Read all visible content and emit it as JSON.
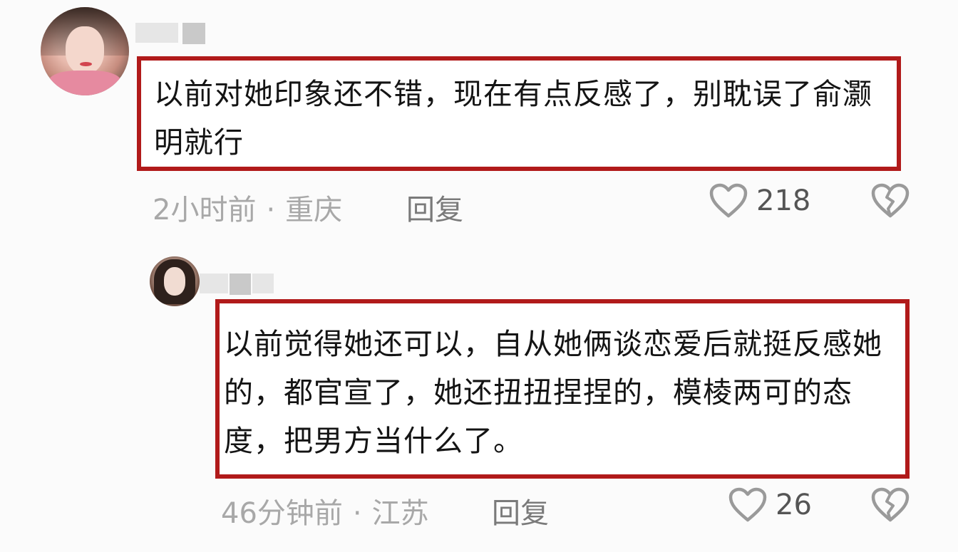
{
  "comments": [
    {
      "text": "以前对她印象还不错，现在有点反感了，别耽误了俞灏明就行",
      "time": "2小时前",
      "separator": "·",
      "location": "重庆",
      "reply_label": "回复",
      "likes": "218"
    },
    {
      "text": "以前觉得她还可以，自从她俩谈恋爱后就挺反感她的，都官宣了，她还扭扭捏捏的，模棱两可的态度，把男方当什么了。",
      "time": "46分钟前",
      "separator": "·",
      "location": "江苏",
      "reply_label": "回复",
      "likes": "26"
    }
  ],
  "icons": {
    "like": "heart-outline-icon",
    "dislike": "broken-heart-icon"
  },
  "colors": {
    "highlight_border": "#b11a1a",
    "meta_text": "#a8a8a8"
  }
}
